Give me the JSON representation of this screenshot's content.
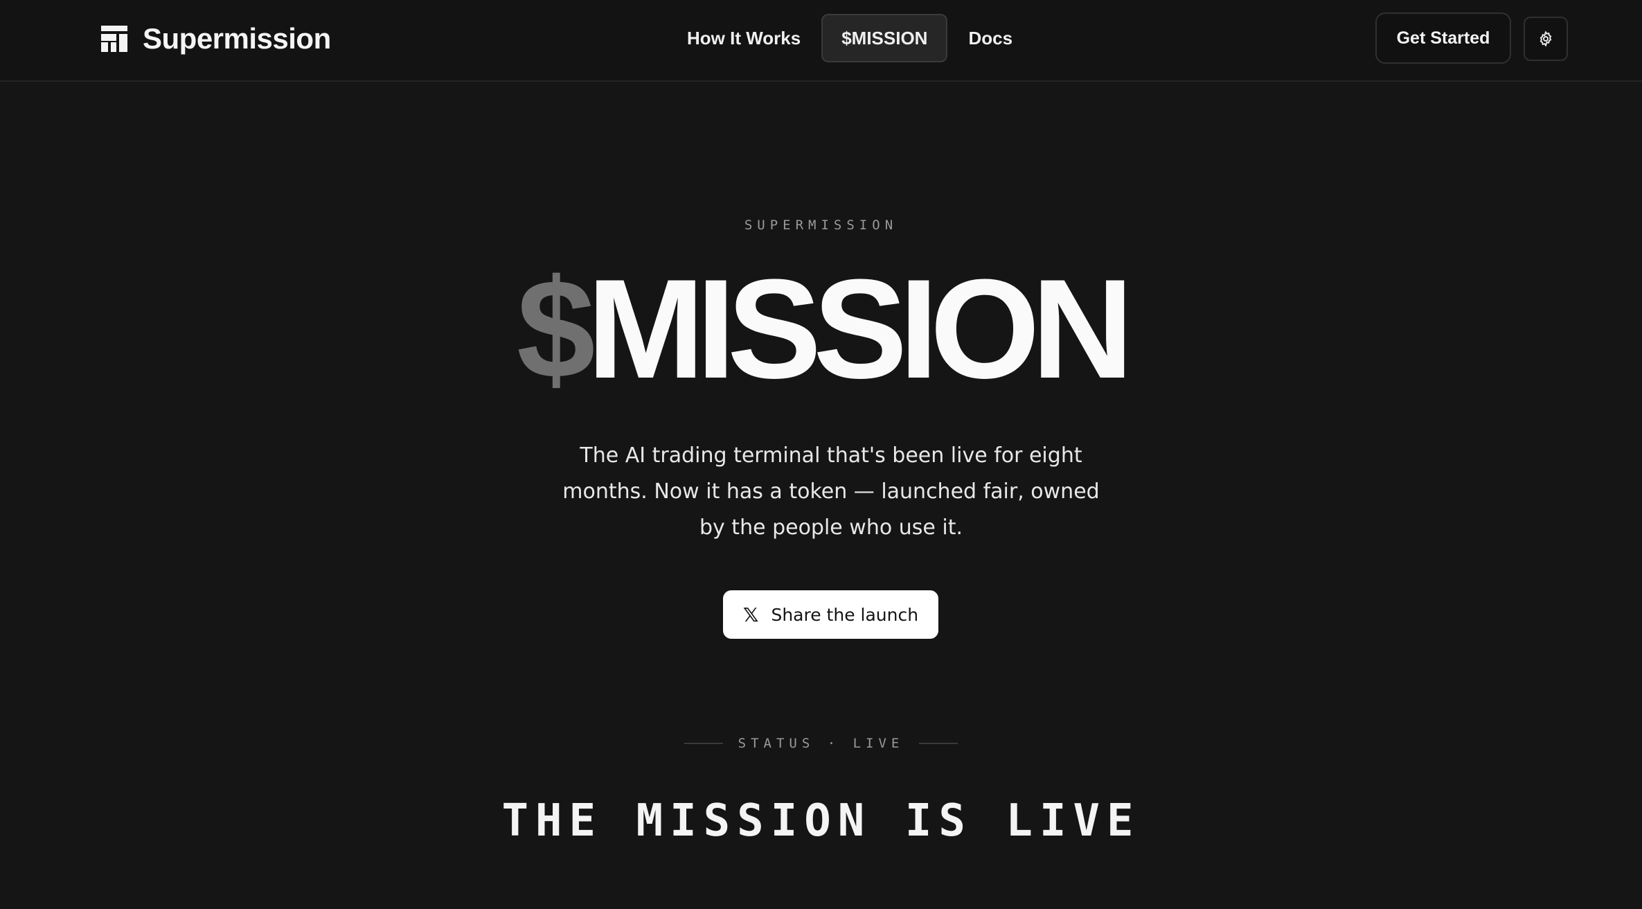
{
  "nav": {
    "brand_name": "Supermission",
    "links": [
      {
        "label": "How It Works",
        "active": false
      },
      {
        "label": "$MISSION",
        "active": true
      },
      {
        "label": "Docs",
        "active": false
      }
    ],
    "get_started": "Get Started",
    "settings_icon": "gear-icon"
  },
  "hero": {
    "eyebrow": "SUPERMISSION",
    "title_dollar": "$",
    "title_word": "MISSION",
    "description": "The AI trading terminal that's been live for eight months. Now it has a token — launched fair, owned by the people who use it.",
    "share_label": "Share the launch",
    "share_icon": "x-logo-icon"
  },
  "status": {
    "label": "STATUS · LIVE",
    "heading": "THE MISSION IS LIVE"
  },
  "colors": {
    "background": "#151515",
    "navbar": "#131313",
    "dollar_gray": "#707070",
    "text": "#fafafa"
  }
}
